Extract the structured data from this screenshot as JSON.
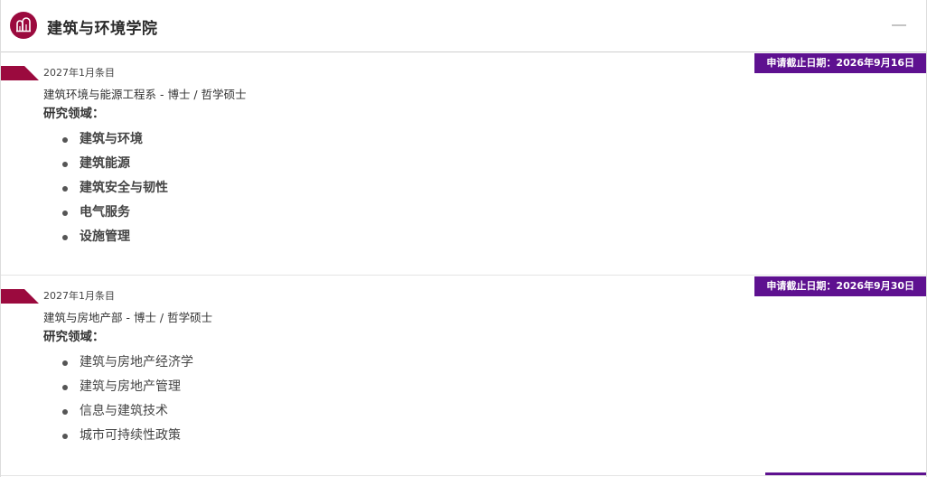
{
  "header": {
    "title": "建筑与环境学院",
    "icon": "school-emblem-icon",
    "accent": "#9b0a3e"
  },
  "colors": {
    "ribbon": "#9b0a3e",
    "deadline_badge": "#5e1190"
  },
  "programs": [
    {
      "intake": "2027年1月条目",
      "deadline": "申请截止日期：2026年9月16日",
      "name": "建筑环境与能源工程系 - 博士 / 哲学硕士",
      "areas_title": "研究领域：",
      "areas": [
        "建筑与环境",
        "建筑能源",
        "建筑安全与韧性",
        "电气服务",
        "设施管理"
      ]
    },
    {
      "intake": "2027年1月条目",
      "deadline": "申请截止日期：2026年9月30日",
      "name": "建筑与房地产部 - 博士 / 哲学硕士",
      "areas_title": "研究领域：",
      "areas": [
        "建筑与房地产经济学",
        "建筑与房地产管理",
        "信息与建筑技术",
        "城市可持续性政策"
      ]
    }
  ]
}
